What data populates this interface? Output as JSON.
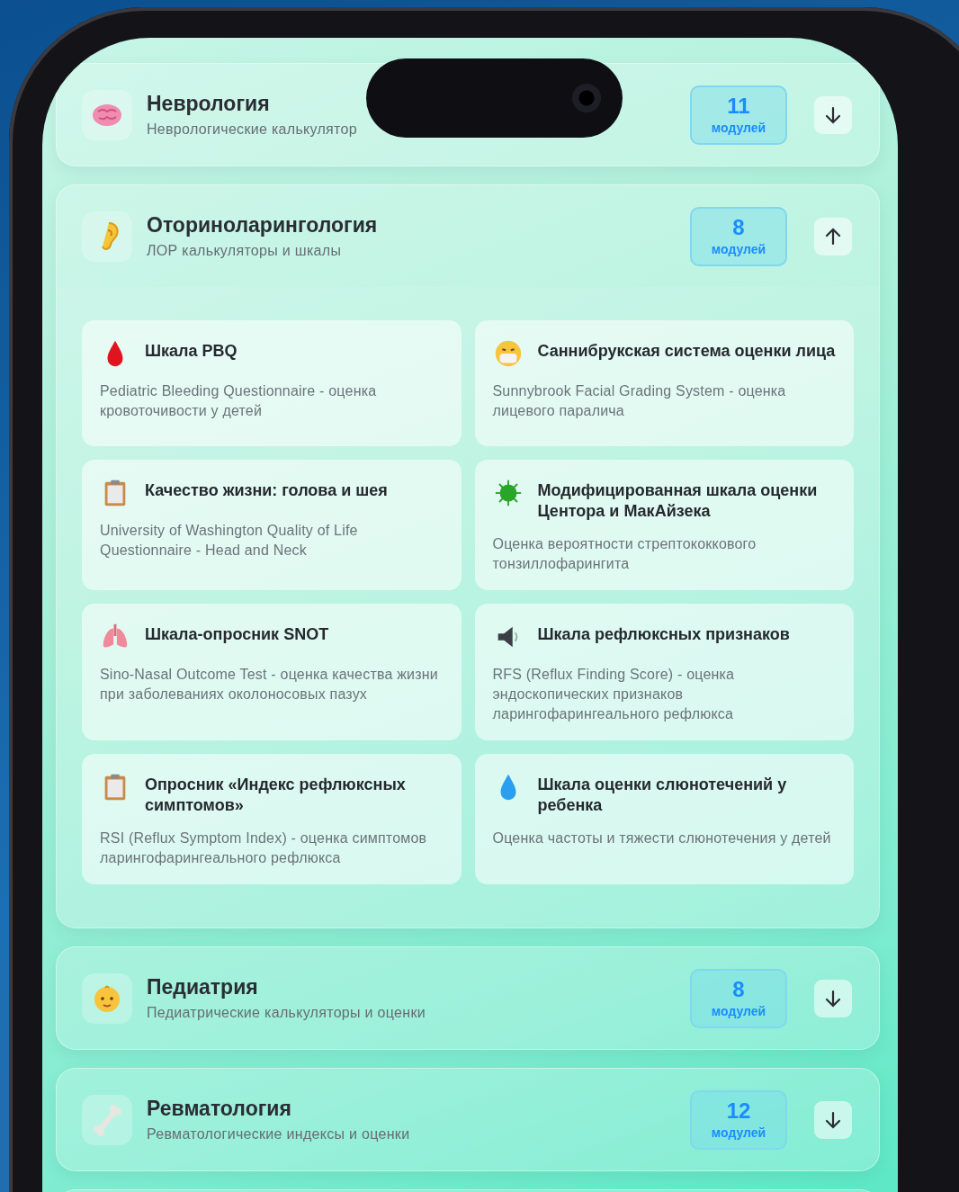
{
  "categories": [
    {
      "title": "Неврология",
      "subtitle": "Неврологические калькулятор",
      "count": "11",
      "unit": "модулей",
      "expanded": false
    },
    {
      "title": "Оториноларингология",
      "subtitle": "ЛОР калькуляторы и шкалы",
      "count": "8",
      "unit": "модулей",
      "expanded": true,
      "modules": [
        {
          "title": "Шкала PBQ",
          "description": "Pediatric Bleeding Questionnaire - оценка кровоточивости у детей"
        },
        {
          "title": "Саннибрукская система оценки лица",
          "description": "Sunnybrook Facial Grading System - оценка лицевого паралича"
        },
        {
          "title": "Качество жизни: голова и шея",
          "description": "University of Washington Quality of Life Questionnaire - Head and Neck"
        },
        {
          "title": "Модифицированная шкала оценки Центора и МакАйзека",
          "description": "Оценка вероятности стрептококкового тонзиллофарингита"
        },
        {
          "title": "Шкала-опросник SNOT",
          "description": "Sino-Nasal Outcome Test - оценка качества жизни при заболеваниях околоносовых пазух"
        },
        {
          "title": "Шкала рефлюксных признаков",
          "description": "RFS (Reflux Finding Score) - оценка эндоскопических признаков ларингофарингеального рефлюкса"
        },
        {
          "title": "Опросник «Индекс рефлюксных симптомов»",
          "description": "RSI (Reflux Symptom Index) - оценка симптомов ларингофарингеального рефлюкса"
        },
        {
          "title": "Шкала оценки слюнотечений у ребенка",
          "description": "Оценка частоты и тяжести слюнотечения у детей"
        }
      ]
    },
    {
      "title": "Педиатрия",
      "subtitle": "Педиатрические калькуляторы и оценки",
      "count": "8",
      "unit": "модулей",
      "expanded": false
    },
    {
      "title": "Ревматология",
      "subtitle": "Ревматологические индексы и оценки",
      "count": "12",
      "unit": "модулей",
      "expanded": false
    }
  ]
}
